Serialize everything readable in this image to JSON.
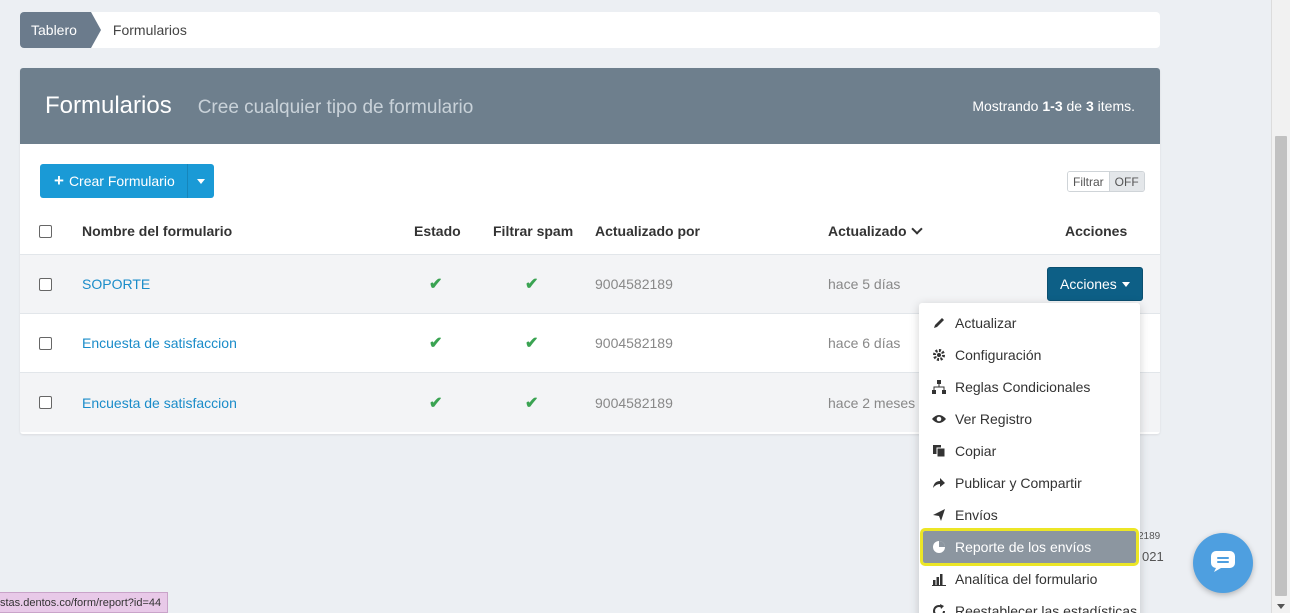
{
  "breadcrumb": {
    "home": "Tablero",
    "current": "Formularios"
  },
  "header": {
    "title": "Formularios",
    "subtitle": "Cree cualquier tipo de formulario",
    "count_prefix": "Mostrando ",
    "count_range": "1-3",
    "count_mid": " de ",
    "count_total": "3",
    "count_suffix": " items."
  },
  "toolbar": {
    "create_label": "Crear Formulario",
    "filter_label": "Filtrar",
    "filter_state": "OFF"
  },
  "table": {
    "columns": [
      "Nombre del formulario",
      "Estado",
      "Filtrar spam",
      "Actualizado por",
      "Actualizado",
      "Acciones"
    ],
    "rows": [
      {
        "name": "SOPORTE",
        "status": "✔",
        "spam": "✔",
        "updated_by": "9004582189",
        "updated": "hace 5 días"
      },
      {
        "name": "Encuesta de satisfaccion",
        "status": "✔",
        "spam": "✔",
        "updated_by": "9004582189",
        "updated": "hace 6 días"
      },
      {
        "name": "Encuesta de satisfaccion",
        "status": "✔",
        "spam": "✔",
        "updated_by": "9004582189",
        "updated": "hace 2 meses"
      }
    ],
    "actions_button": "Acciones"
  },
  "dropdown": {
    "items": [
      {
        "label": "Actualizar",
        "icon": "pencil-icon"
      },
      {
        "label": "Configuración",
        "icon": "gear-icon"
      },
      {
        "label": "Reglas Condicionales",
        "icon": "sitemap-icon"
      },
      {
        "label": "Ver Registro",
        "icon": "eye-icon"
      },
      {
        "label": "Copiar",
        "icon": "copy-icon"
      },
      {
        "label": "Publicar y Compartir",
        "icon": "share-icon"
      },
      {
        "label": "Envíos",
        "icon": "send-icon"
      },
      {
        "label": "Reporte de los envíos",
        "icon": "pie-chart-icon"
      },
      {
        "label": "Analítica del formulario",
        "icon": "bar-chart-icon"
      },
      {
        "label": "Reestablecer las estadísticas",
        "icon": "refresh-icon"
      }
    ]
  },
  "footer": {
    "snippet1": "2189",
    "snippet2": "021"
  },
  "status_bar": {
    "url": "stas.dentos.co/form/report?id=44"
  },
  "colors": {
    "header_bg": "#6e7f8d",
    "primary": "#1a9ad6",
    "actions_btn": "#0d5f86",
    "highlight": "#ece626",
    "success": "#3aa352"
  }
}
